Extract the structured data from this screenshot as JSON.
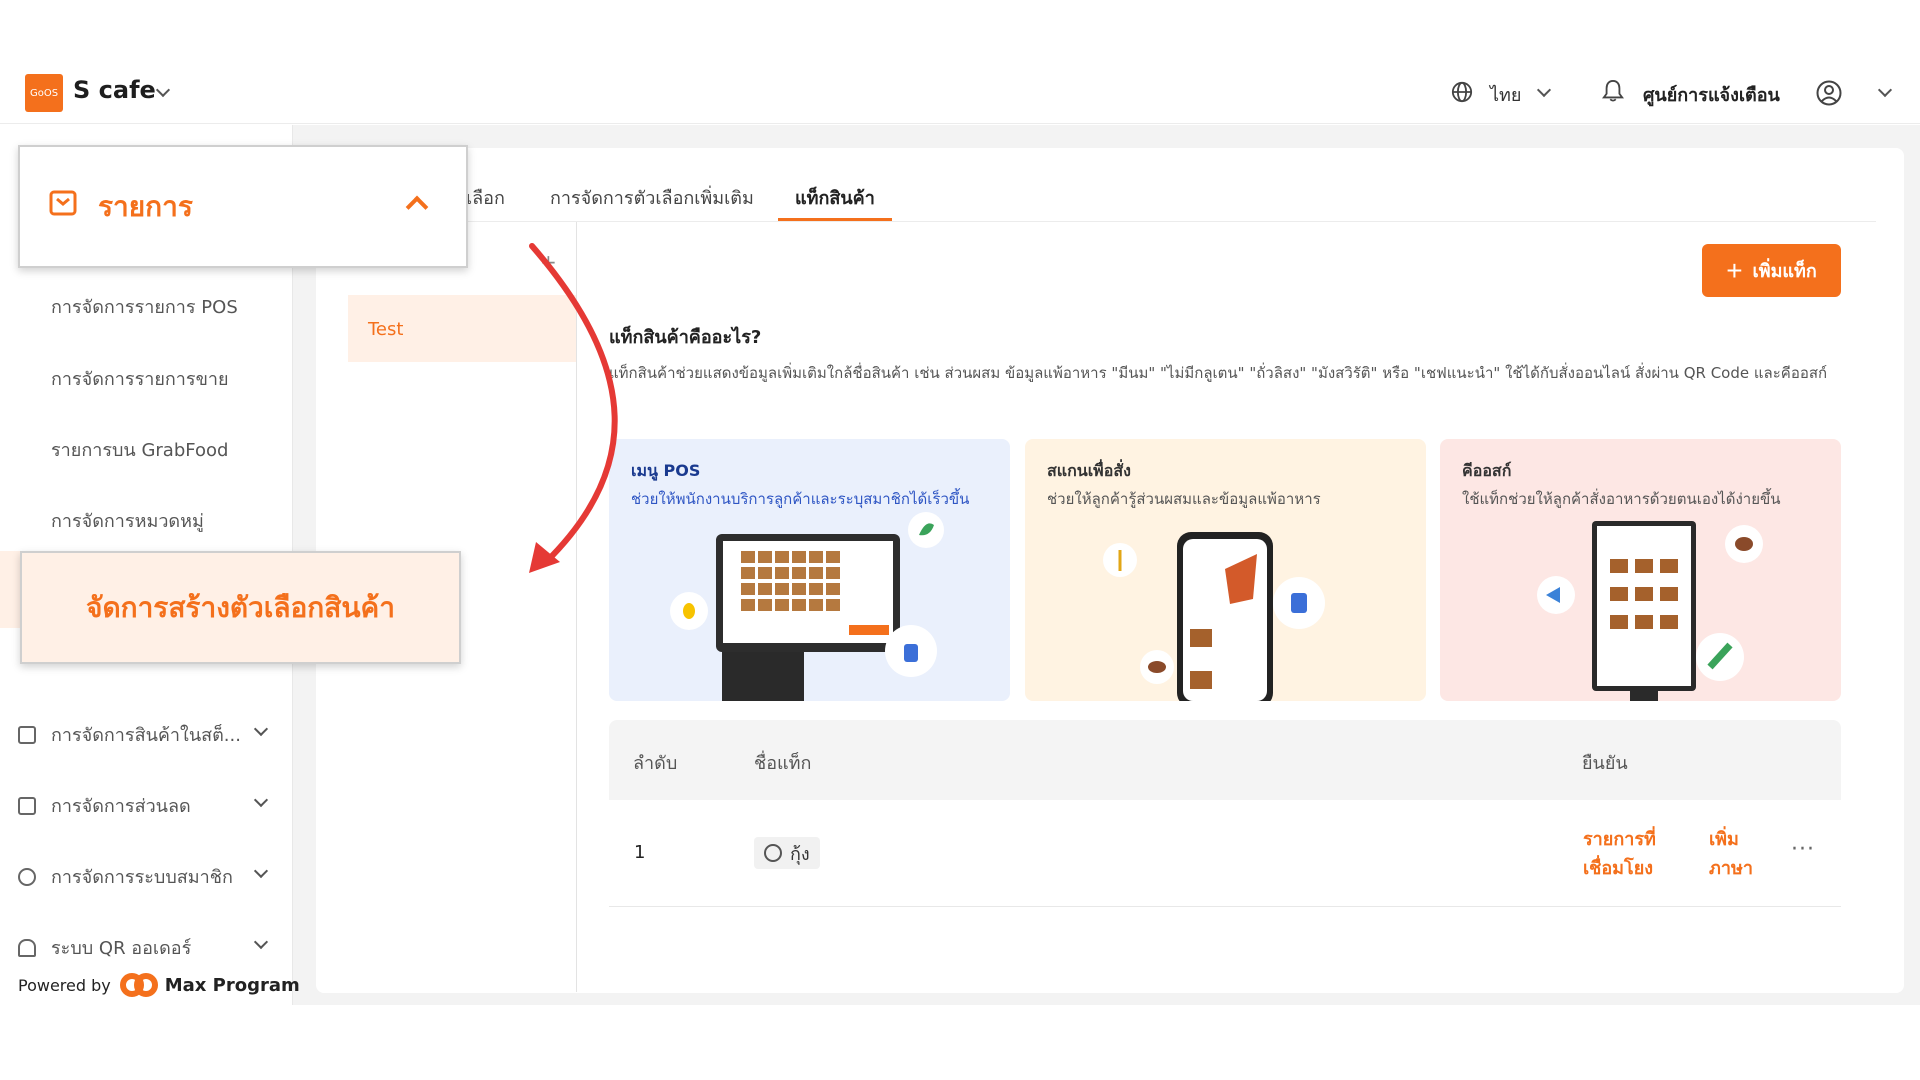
{
  "header": {
    "logo_text": "GoOS",
    "shop_name": "S cafe",
    "language": "ไทย",
    "notification_center": "ศูนย์การแจ้งเตือน"
  },
  "sidebar": {
    "sub_items": [
      "การจัดการรายการ POS",
      "การจัดการรายการขาย",
      "รายการบน GrabFood",
      "การจัดการหมวดหมู่"
    ],
    "groups": [
      "การจัดการสินค้าในสต็...",
      "การจัดการส่วนลด",
      "การจัดการระบบสมาชิก",
      "ระบบ QR ออเดอร์"
    ],
    "powered_by": "Powered by",
    "brand": "Max Program"
  },
  "tabs": [
    {
      "label": "เลือก"
    },
    {
      "label": "การจัดการตัวเลือกเพิ่มเติม"
    },
    {
      "label": "แท็กสินค้า"
    }
  ],
  "tag_list": {
    "selected_item": "Test"
  },
  "add_tag_button": "เพิ่มแท็ก",
  "info": {
    "title": "แท็กสินค้าคืออะไร?",
    "description": "แท็กสินค้าช่วยแสดงข้อมูลเพิ่มเติมใกล้ชื่อสินค้า เช่น ส่วนผสม ข้อมูลแพ้อาหาร \"มีนม\" \"ไม่มีกลูเตน\" \"ถั่วลิสง\" \"มังสวิรัติ\" หรือ \"เชฟแนะนำ\" ใช้ได้กับสั่งออนไลน์ สั่งผ่าน QR Code และคีออสก์"
  },
  "cards": [
    {
      "title": "เมนู POS",
      "desc": "ช่วยให้พนักงานบริการลูกค้าและระบุสมาชิกได้เร็วขึ้น",
      "bg": "#eaf0fc",
      "title_color": "#1a3a8f",
      "desc_color": "#2f56c4"
    },
    {
      "title": "สแกนเพื่อสั่ง",
      "desc": "ช่วยให้ลูกค้ารู้ส่วนผสมและข้อมูลแพ้อาหาร",
      "bg": "#fff3e2",
      "title_color": "#333333",
      "desc_color": "#555555"
    },
    {
      "title": "คีออสก์",
      "desc": "ใช้แท็กช่วยให้ลูกค้าสั่งอาหารด้วยตนเองได้ง่ายขึ้น",
      "bg": "#fde7e4",
      "title_color": "#333333",
      "desc_color": "#555555"
    }
  ],
  "table": {
    "headers": [
      "ลำดับ",
      "ชื่อแท็ก",
      "ยืนยัน"
    ],
    "rows": [
      {
        "index": "1",
        "tag": "กุ้ง",
        "linked_line1": "รายการที่",
        "linked_line2": "เชื่อมโยง",
        "add_line1": "เพิ่ม",
        "add_line2": "ภาษา",
        "more": "···"
      }
    ]
  },
  "overlays": {
    "menu_label": "รายการ",
    "option_label": "จัดการสร้างตัวเลือกสินค้า"
  },
  "colors": {
    "accent": "#f4701c",
    "arrow": "#e53935"
  }
}
